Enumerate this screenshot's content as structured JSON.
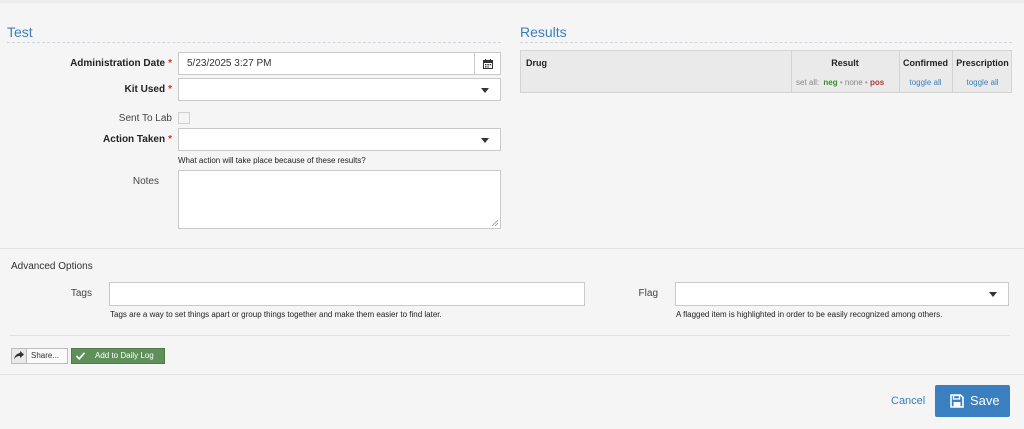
{
  "test": {
    "title": "Test",
    "administration_date": {
      "label": "Administration Date",
      "required": "*",
      "value": "5/23/2025 3:27 PM",
      "icon": "calendar-icon"
    },
    "kit_used": {
      "label": "Kit Used",
      "required": "*",
      "value": ""
    },
    "sent_to_lab": {
      "label": "Sent To Lab"
    },
    "action_taken": {
      "label": "Action Taken",
      "required": "*",
      "value": "",
      "help": "What action will take place because of these results?"
    },
    "notes": {
      "label": "Notes",
      "value": ""
    }
  },
  "results": {
    "title": "Results",
    "columns": {
      "drug": "Drug",
      "result": "Result",
      "confirmed": "Confirmed",
      "prescription": "Prescription"
    },
    "set_all_label": "set all:",
    "neg": "neg",
    "none": "none",
    "pos": "pos",
    "sep": "•",
    "toggle_all_confirmed": "toggle all",
    "toggle_all_prescription": "toggle all",
    "colors": {
      "neg": "#3c8a2e",
      "pos": "#b23a3a",
      "none": "#888888"
    }
  },
  "advanced": {
    "title": "Advanced Options",
    "tags": {
      "label": "Tags",
      "value": "",
      "help": "Tags are a way to set things apart or group things together and make them easier to find later."
    },
    "flag": {
      "label": "Flag",
      "value": "",
      "help": "A flagged item is highlighted in order to be easily recognized among others."
    }
  },
  "actions": {
    "share_label": "Share...",
    "share_icon": "share-icon",
    "daily_log_label": "Add to Daily Log",
    "daily_log_icon": "check-icon",
    "cancel_label": "Cancel",
    "save_label": "Save",
    "save_icon": "floppy-disk-icon",
    "accent": "#3a7fc0",
    "daily_log_color": "#5f8f5a"
  }
}
